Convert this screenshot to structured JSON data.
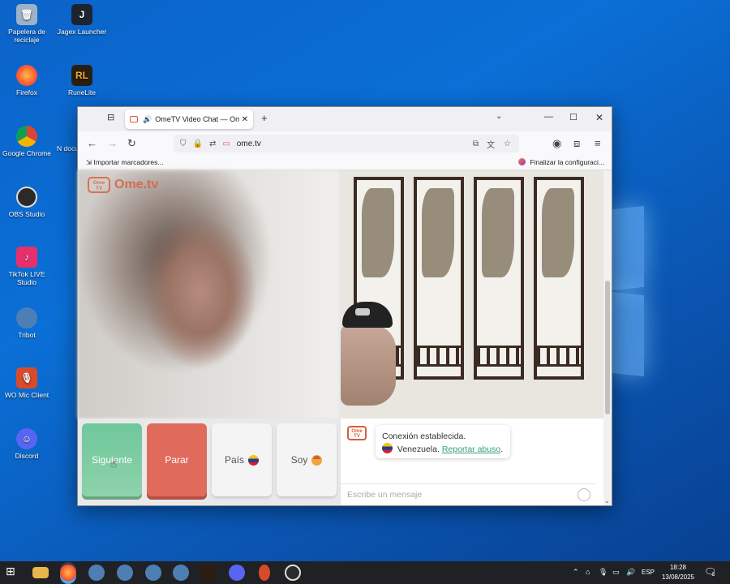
{
  "desktop": {
    "icons": [
      {
        "label": "Papelera de reciclaje",
        "color": "#9bb3c9"
      },
      {
        "label": "Jagex Launcher",
        "color": "#1c2430"
      },
      {
        "label": "Firefox",
        "color": "#ff7b2a"
      },
      {
        "label": "RuneLite",
        "color": "#2a1e12"
      },
      {
        "label": "Google Chrome",
        "color": "#db4437"
      },
      {
        "label": "OBS Studio",
        "color": "#2a2a2a"
      },
      {
        "label": "TikTok LIVE Studio",
        "color": "#e6306b"
      },
      {
        "label": "Tribot",
        "color": "#4d7fb5"
      },
      {
        "label": "WO Mic Client",
        "color": "#d94a2a"
      },
      {
        "label": "Discord",
        "color": "#5865f2"
      }
    ],
    "partial_text": "N docu"
  },
  "browser": {
    "tab_title": "OmeTV Video Chat — Ome",
    "tab_close": "✕",
    "new_tab": "+",
    "url": "ome.tv",
    "bookmarks_left": "Importar marcadores...",
    "bookmarks_right": "Finalizar la configuraci..."
  },
  "page": {
    "logo_text": "Ome.tv",
    "logo_badge": "Ome TV",
    "buttons": {
      "next": "Siguiente",
      "stop": "Parar",
      "country": "País",
      "gender": "Soy"
    },
    "chat": {
      "line1": "Conexión establecida.",
      "country": "Venezuela.",
      "report": "Reportar abuso",
      "period": ".",
      "placeholder": "Escribe un mensaje"
    }
  },
  "taskbar": {
    "language": "ESP",
    "time": "18:28",
    "date": "13/08/2025",
    "notifications": "5"
  }
}
